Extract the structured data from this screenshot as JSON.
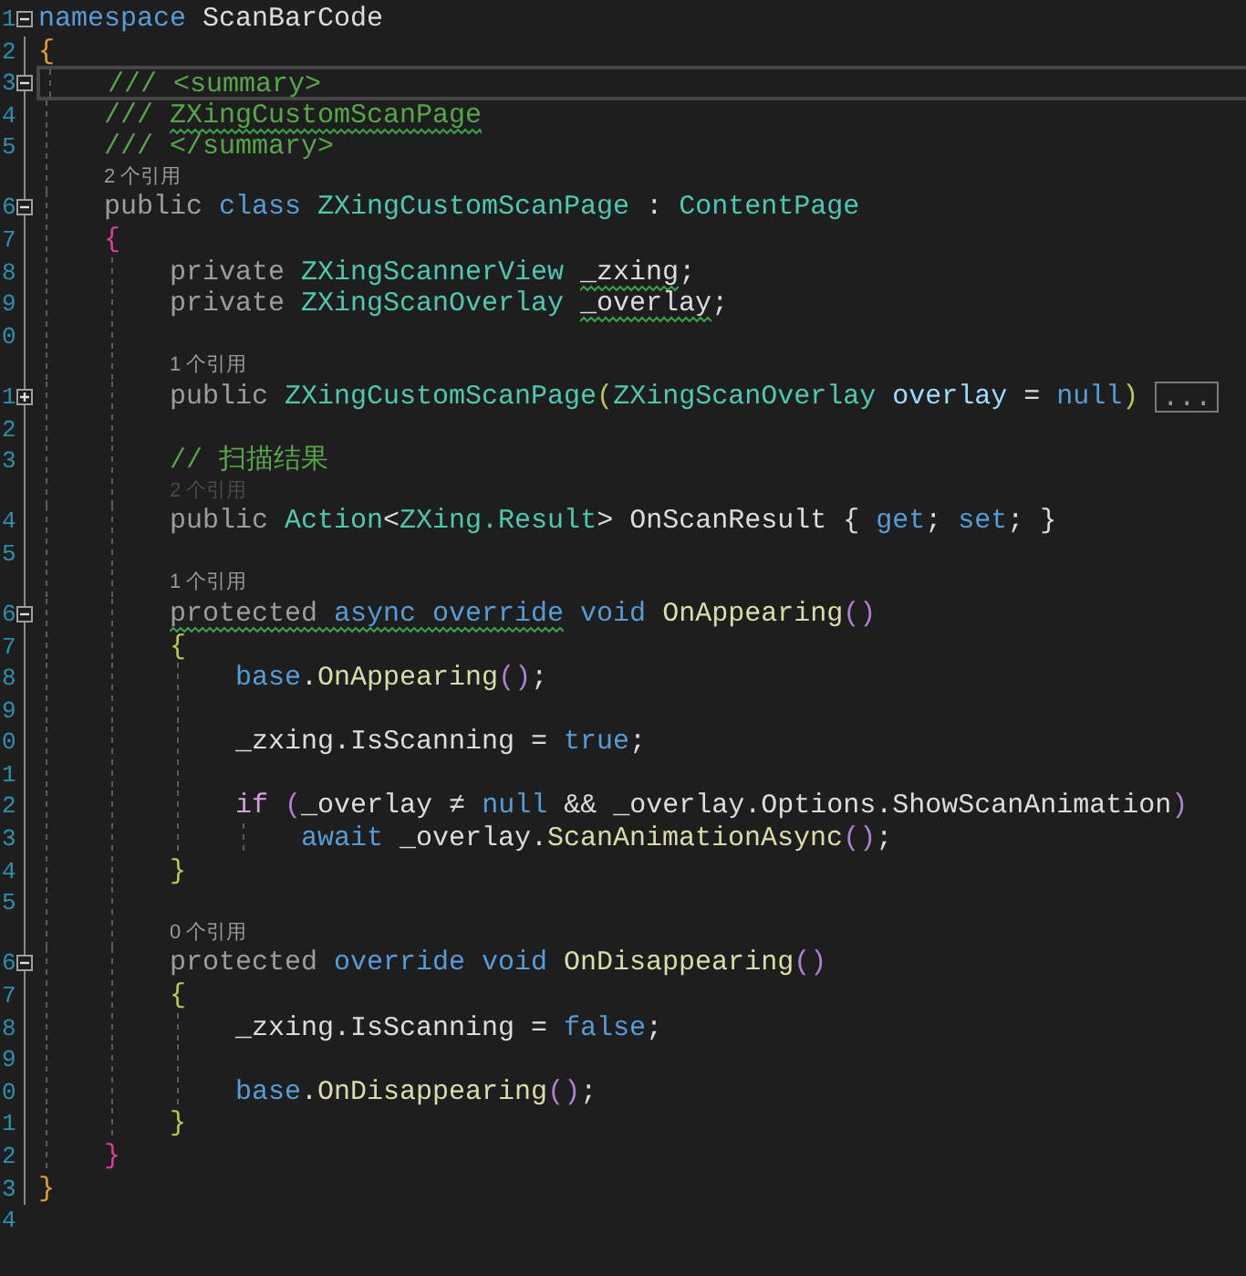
{
  "lines": [
    {
      "kind": "code",
      "number": "1",
      "collapsible": true,
      "expanded": true,
      "tokens": [
        {
          "text": "namespace",
          "kind": "kw"
        },
        {
          "text": " ScanBarCode",
          "kind": "id"
        }
      ]
    },
    {
      "kind": "code",
      "number": "2",
      "tokens": [
        {
          "text": "{",
          "kind": "b1"
        }
      ],
      "children": [
        {
          "kind": "code",
          "number": "3",
          "collapsible": true,
          "expanded": true,
          "current": true,
          "tokens": [
            {
              "text": "/// <summary>",
              "kind": "cm"
            }
          ]
        },
        {
          "kind": "code",
          "number": "4",
          "tokens": [
            {
              "text": "/// ",
              "kind": "cm"
            },
            {
              "text": "ZXingCustomScanPage",
              "kind": "cm",
              "squiggle": true
            }
          ]
        },
        {
          "kind": "code",
          "number": "5",
          "tokens": [
            {
              "text": "/// </summary>",
              "kind": "cm"
            }
          ]
        },
        {
          "kind": "lens",
          "text": "2 个引用"
        },
        {
          "kind": "code",
          "number": "6",
          "collapsible": true,
          "expanded": true,
          "tokens": [
            {
              "text": "public ",
              "kind": "mod"
            },
            {
              "text": "class ",
              "kind": "kw"
            },
            {
              "text": "ZXingCustomScanPage",
              "kind": "type"
            },
            {
              "text": " : ",
              "kind": "id"
            },
            {
              "text": "ContentPage",
              "kind": "type"
            }
          ]
        },
        {
          "kind": "code",
          "number": "7",
          "tokens": [
            {
              "text": "{",
              "kind": "b2"
            }
          ],
          "children": [
            {
              "kind": "code",
              "number": "8",
              "tokens": [
                {
                  "text": "private ",
                  "kind": "mod"
                },
                {
                  "text": "ZXingScannerView ",
                  "kind": "type"
                },
                {
                  "text": "_zxing",
                  "kind": "id",
                  "squiggle": true
                },
                {
                  "text": ";",
                  "kind": "id"
                }
              ]
            },
            {
              "kind": "code",
              "number": "9",
              "tokens": [
                {
                  "text": "private ",
                  "kind": "mod"
                },
                {
                  "text": "ZXingScanOverlay ",
                  "kind": "type"
                },
                {
                  "text": "_overlay",
                  "kind": "id",
                  "squiggle": true
                },
                {
                  "text": ";",
                  "kind": "id"
                }
              ]
            },
            {
              "kind": "code",
              "number": "0"
            },
            {
              "kind": "lens",
              "text": "1 个引用"
            },
            {
              "kind": "code",
              "number": "1",
              "collapsible": true,
              "expanded": false,
              "collapsed_marker": "...",
              "tokens": [
                {
                  "text": "public ",
                  "kind": "mod"
                },
                {
                  "text": "ZXingCustomScanPage",
                  "kind": "type"
                },
                {
                  "text": "(",
                  "kind": "b3"
                },
                {
                  "text": "ZXingScanOverlay ",
                  "kind": "type"
                },
                {
                  "text": "overlay",
                  "kind": "param"
                },
                {
                  "text": " = ",
                  "kind": "id"
                },
                {
                  "text": "null",
                  "kind": "kw"
                },
                {
                  "text": ")",
                  "kind": "b3"
                }
              ]
            },
            {
              "kind": "code",
              "number": "2"
            },
            {
              "kind": "code",
              "number": "3",
              "tokens": [
                {
                  "text": "// 扫描结果",
                  "kind": "cm"
                }
              ]
            },
            {
              "kind": "lens",
              "text": "2 个引用",
              "faded": true
            },
            {
              "kind": "code",
              "number": "4",
              "tokens": [
                {
                  "text": "public ",
                  "kind": "mod"
                },
                {
                  "text": "Action",
                  "kind": "type"
                },
                {
                  "text": "<",
                  "kind": "id"
                },
                {
                  "text": "ZXing.Result",
                  "kind": "type"
                },
                {
                  "text": "> OnScanResult { ",
                  "kind": "id"
                },
                {
                  "text": "get",
                  "kind": "kw"
                },
                {
                  "text": "; ",
                  "kind": "id"
                },
                {
                  "text": "set",
                  "kind": "kw"
                },
                {
                  "text": "; }",
                  "kind": "id"
                }
              ]
            },
            {
              "kind": "code",
              "number": "5"
            },
            {
              "kind": "lens",
              "text": "1 个引用"
            },
            {
              "kind": "code",
              "number": "6",
              "collapsible": true,
              "expanded": true,
              "tokens": [
                {
                  "text": "protected ",
                  "kind": "mod",
                  "squiggle": true
                },
                {
                  "text": "async ",
                  "kind": "kw",
                  "squiggle": true
                },
                {
                  "text": "override",
                  "kind": "kw",
                  "squiggle": true
                },
                {
                  "text": " void ",
                  "kind": "kw"
                },
                {
                  "text": "OnAppearing",
                  "kind": "method"
                },
                {
                  "text": "()",
                  "kind": "b4"
                }
              ]
            },
            {
              "kind": "code",
              "number": "7",
              "tokens": [
                {
                  "text": "{",
                  "kind": "b3"
                }
              ],
              "children": [
                {
                  "kind": "code",
                  "number": "8",
                  "tokens": [
                    {
                      "text": "base",
                      "kind": "kw"
                    },
                    {
                      "text": ".",
                      "kind": "id"
                    },
                    {
                      "text": "OnAppearing",
                      "kind": "method"
                    },
                    {
                      "text": "()",
                      "kind": "b4"
                    },
                    {
                      "text": ";",
                      "kind": "id"
                    }
                  ]
                },
                {
                  "kind": "code",
                  "number": "9"
                },
                {
                  "kind": "code",
                  "number": "0",
                  "tokens": [
                    {
                      "text": "_zxing.IsScanning = ",
                      "kind": "id"
                    },
                    {
                      "text": "true",
                      "kind": "kw"
                    },
                    {
                      "text": ";",
                      "kind": "id"
                    }
                  ]
                },
                {
                  "kind": "code",
                  "number": "1"
                },
                {
                  "kind": "code",
                  "number": "2",
                  "tokens": [
                    {
                      "text": "if ",
                      "kind": "ctl"
                    },
                    {
                      "text": "(",
                      "kind": "b4"
                    },
                    {
                      "text": "_overlay ≠ ",
                      "kind": "id"
                    },
                    {
                      "text": "null",
                      "kind": "kw"
                    },
                    {
                      "text": " && _overlay.Options.ShowScanAnimation",
                      "kind": "id"
                    },
                    {
                      "text": ")",
                      "kind": "b4"
                    }
                  ],
                  "children": [
                    {
                      "kind": "code",
                      "number": "3",
                      "tokens": [
                        {
                          "text": "await",
                          "kind": "kw"
                        },
                        {
                          "text": " _overlay.",
                          "kind": "id"
                        },
                        {
                          "text": "ScanAnimationAsync",
                          "kind": "method"
                        },
                        {
                          "text": "()",
                          "kind": "b4"
                        },
                        {
                          "text": ";",
                          "kind": "id"
                        }
                      ]
                    }
                  ]
                }
              ]
            },
            {
              "kind": "code",
              "number": "4",
              "tokens": [
                {
                  "text": "}",
                  "kind": "b3"
                }
              ]
            },
            {
              "kind": "code",
              "number": "5"
            },
            {
              "kind": "lens",
              "text": "0 个引用"
            },
            {
              "kind": "code",
              "number": "6",
              "collapsible": true,
              "expanded": true,
              "tokens": [
                {
                  "text": "protected ",
                  "kind": "mod"
                },
                {
                  "text": "override void ",
                  "kind": "kw"
                },
                {
                  "text": "OnDisappearing",
                  "kind": "method"
                },
                {
                  "text": "()",
                  "kind": "b4"
                }
              ]
            },
            {
              "kind": "code",
              "number": "7",
              "tokens": [
                {
                  "text": "{",
                  "kind": "b3"
                }
              ],
              "children": [
                {
                  "kind": "code",
                  "number": "8",
                  "tokens": [
                    {
                      "text": "_zxing.IsScanning = ",
                      "kind": "id"
                    },
                    {
                      "text": "false",
                      "kind": "kw"
                    },
                    {
                      "text": ";",
                      "kind": "id"
                    }
                  ]
                },
                {
                  "kind": "code",
                  "number": "9"
                },
                {
                  "kind": "code",
                  "number": "0",
                  "tokens": [
                    {
                      "text": "base",
                      "kind": "kw"
                    },
                    {
                      "text": ".",
                      "kind": "id"
                    },
                    {
                      "text": "OnDisappearing",
                      "kind": "method"
                    },
                    {
                      "text": "()",
                      "kind": "b4"
                    },
                    {
                      "text": ";",
                      "kind": "id"
                    }
                  ]
                }
              ]
            },
            {
              "kind": "code",
              "number": "1",
              "tokens": [
                {
                  "text": "}",
                  "kind": "b3"
                }
              ]
            }
          ]
        },
        {
          "kind": "code",
          "number": "2",
          "tokens": [
            {
              "text": "}",
              "kind": "b2"
            }
          ]
        }
      ]
    },
    {
      "kind": "code",
      "number": "3",
      "tokens": [
        {
          "text": "}",
          "kind": "b1"
        }
      ]
    },
    {
      "kind": "code",
      "number": "4"
    }
  ]
}
